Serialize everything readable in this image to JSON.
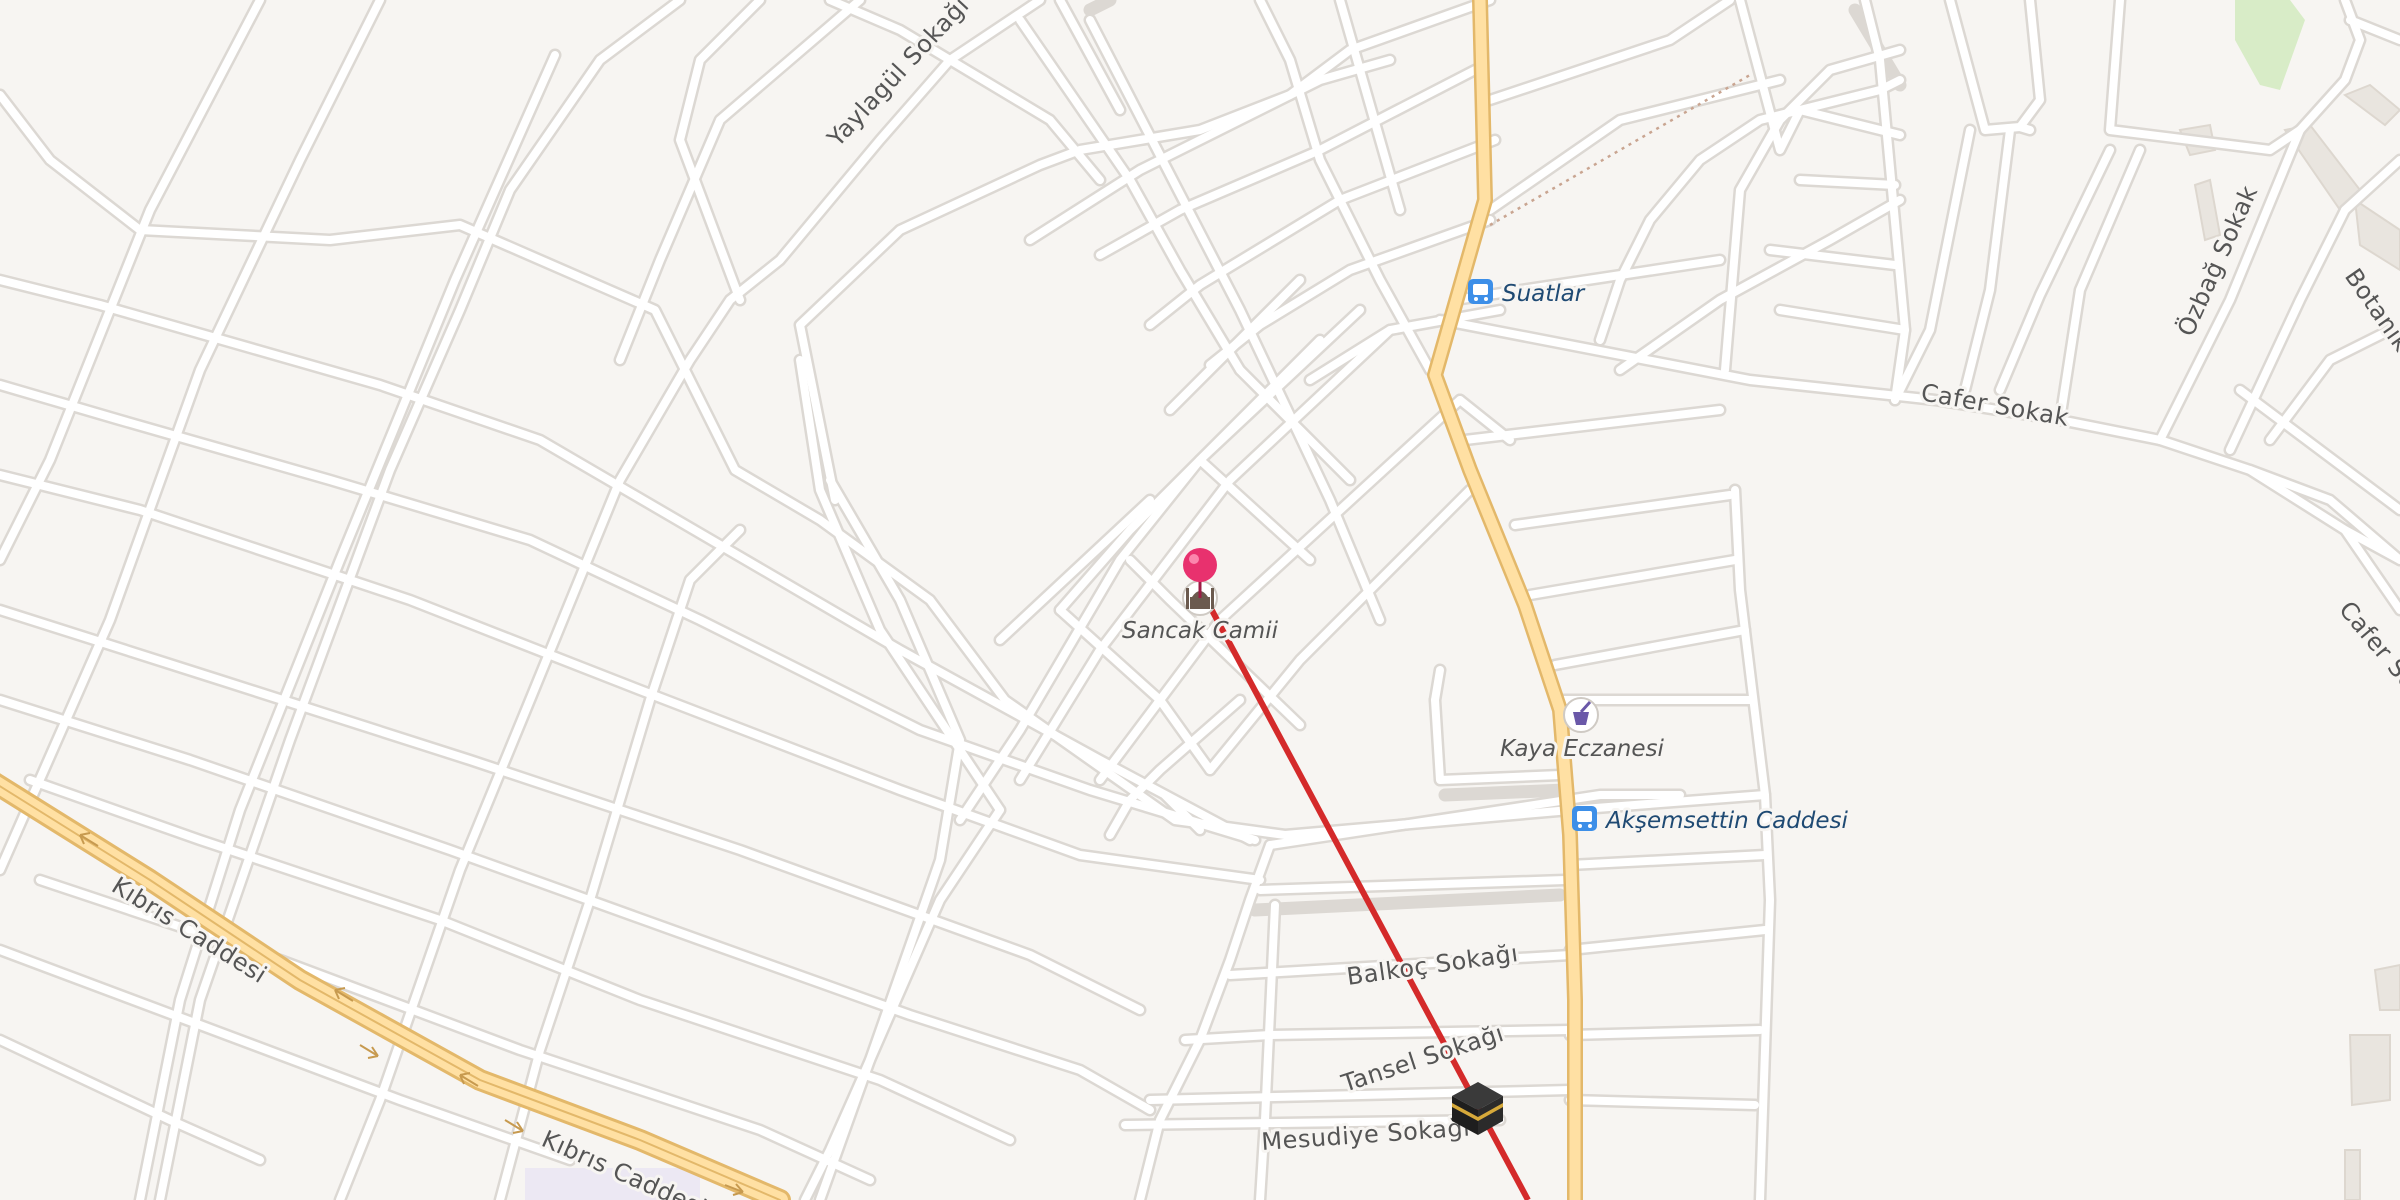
{
  "map": {
    "colors": {
      "background": "#f7f5f2",
      "minor_road": "#ffffff",
      "minor_road_casing": "#dcd8d3",
      "major_road": "#ffe0a3",
      "major_road_casing": "#e3b86a",
      "park": "#d8ecc7",
      "building": "#e9e5df",
      "route_line": "#d42a2a",
      "pin": "#e8316e",
      "bus_stop": "#3d8fe8",
      "path": "#c9a591"
    },
    "streets": [
      {
        "name": "Yaylagül Sokağı"
      },
      {
        "name": "Kıbrıs Caddesi"
      },
      {
        "name": "Kıbrıs Caddesi"
      },
      {
        "name": "Cafer Sokak"
      },
      {
        "name": "Cafer Sok"
      },
      {
        "name": "Özbağ Sokak"
      },
      {
        "name": "Botanik"
      },
      {
        "name": "Balkoç Sokağı"
      },
      {
        "name": "Tansel Sokağı"
      },
      {
        "name": "Mesudiye Sokağı"
      }
    ],
    "pois": [
      {
        "name": "Sancak Camii",
        "icon": "mosque-icon"
      },
      {
        "name": "Kaya Eczanesi",
        "icon": "pharmacy-icon"
      }
    ],
    "bus_stops": [
      {
        "name": "Suatlar",
        "icon": "bus-stop-icon"
      },
      {
        "name": "Akşemsettin Caddesi",
        "icon": "bus-stop-icon"
      }
    ],
    "markers": [
      {
        "name": "location-pin",
        "icon": "pin-icon"
      },
      {
        "name": "kaaba",
        "icon": "kaaba-icon"
      }
    ],
    "route": {
      "description_icon": "qibla-direction-line"
    }
  }
}
